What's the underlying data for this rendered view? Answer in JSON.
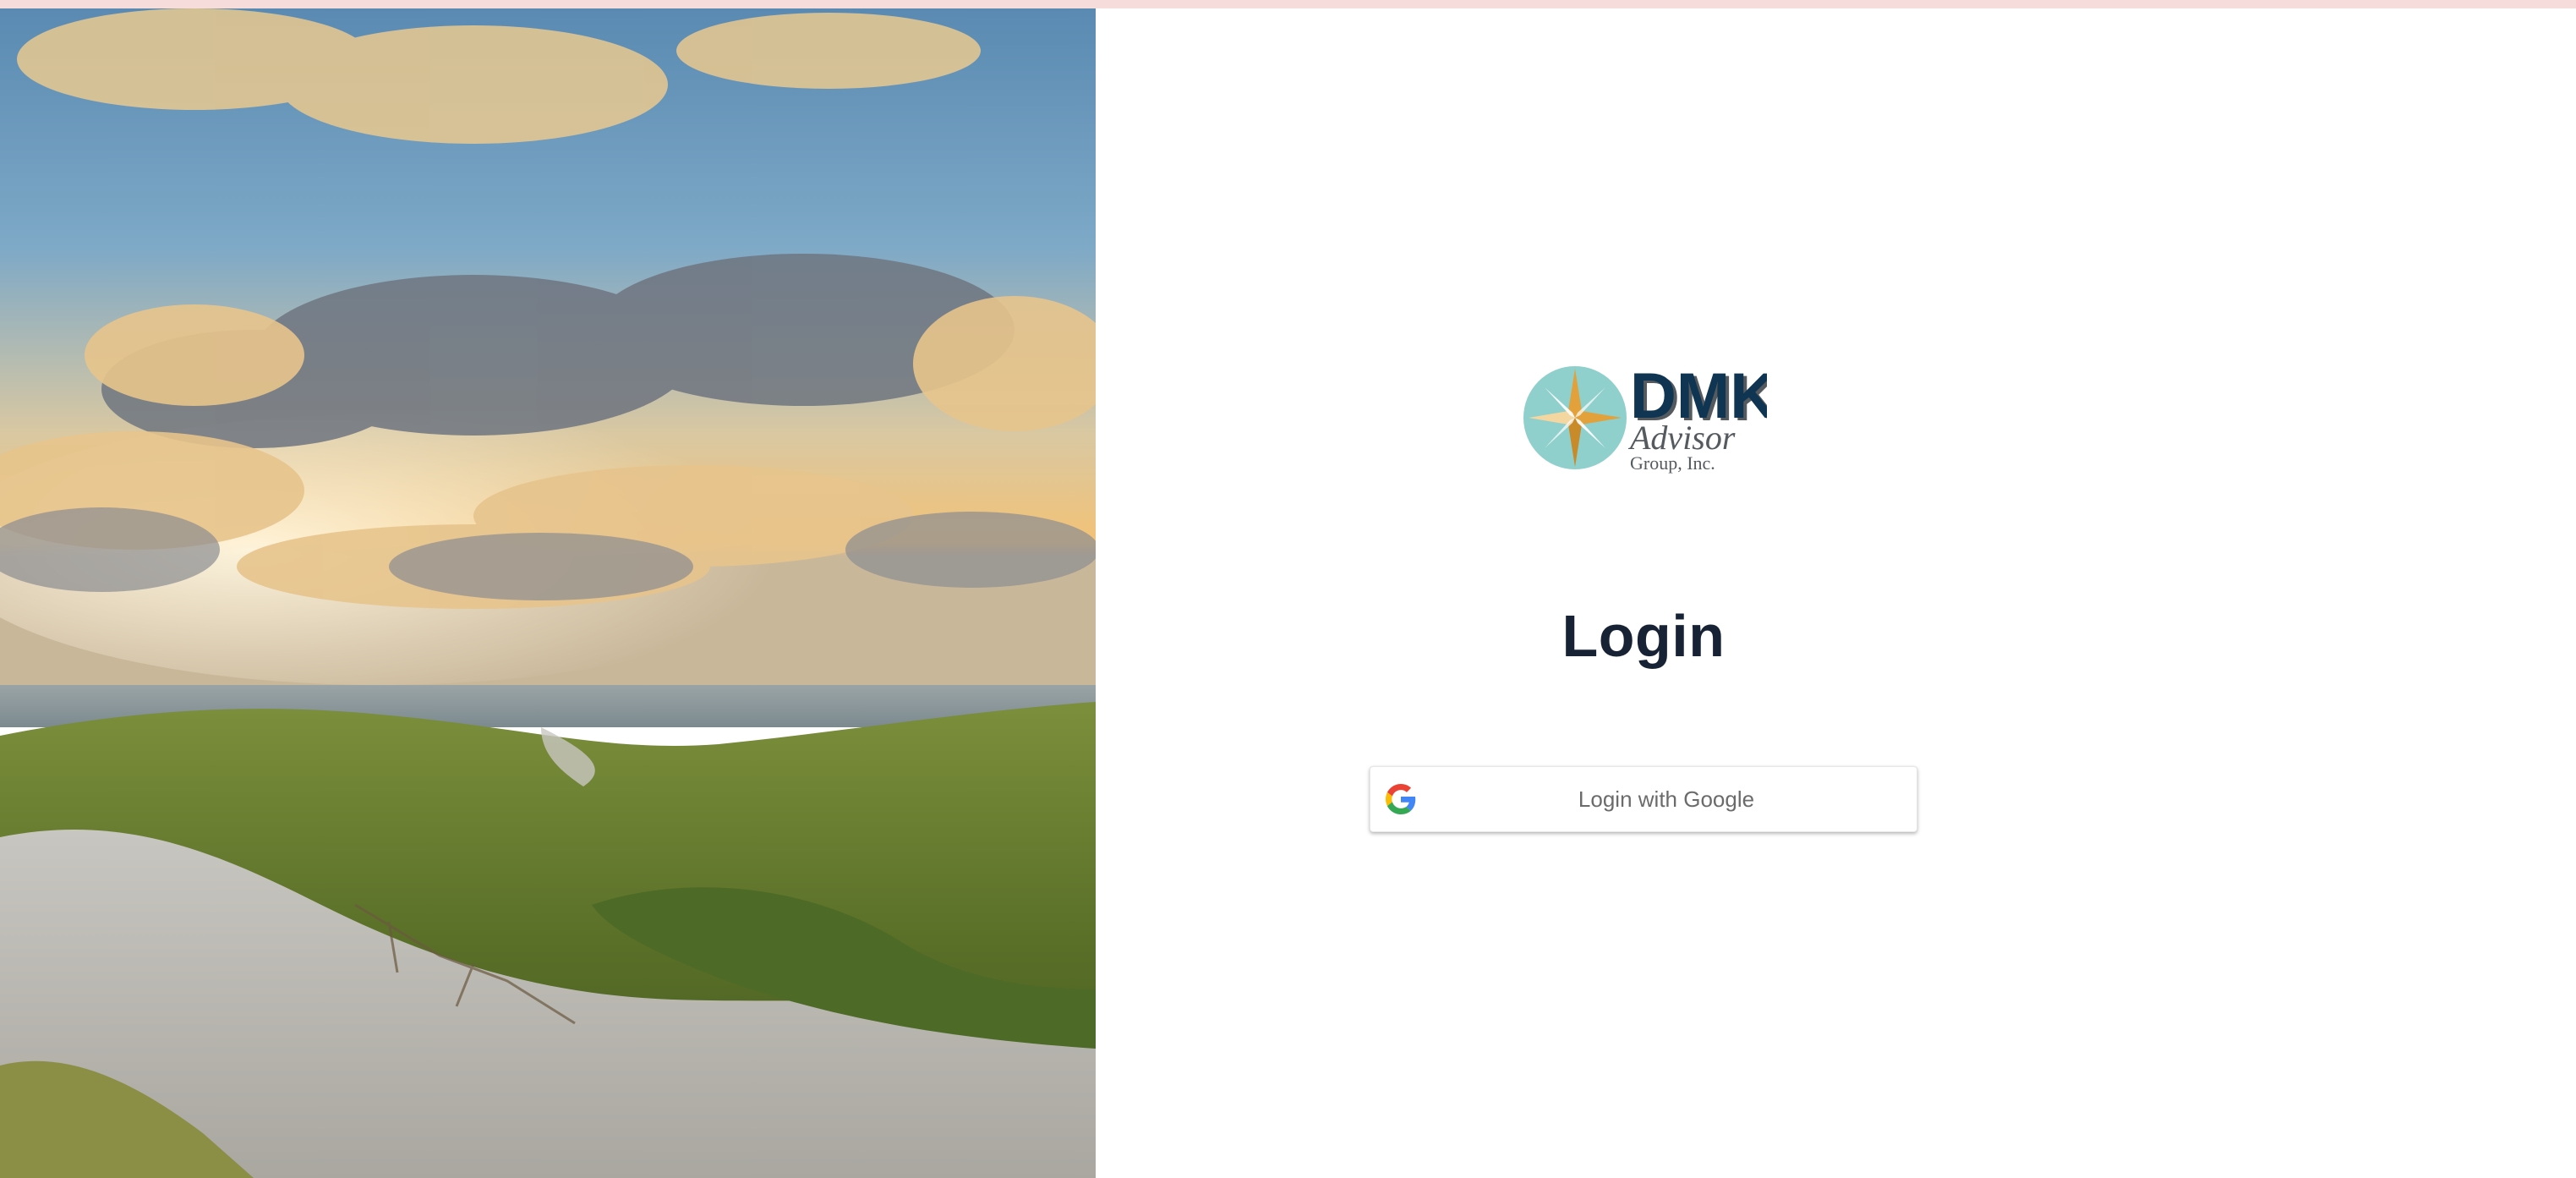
{
  "brand": {
    "logo_mark": "DMK",
    "logo_line2": "Advisor",
    "logo_line3": "Group, Inc.",
    "colors": {
      "teal": "#8fcfcc",
      "navy": "#0f3552",
      "gold": "#e2a13a"
    }
  },
  "login": {
    "title": "Login",
    "google_button_label": "Login with Google",
    "google_icon": "google-g-icon"
  },
  "hero": {
    "image": "beach-dunes-sunset-photo"
  }
}
